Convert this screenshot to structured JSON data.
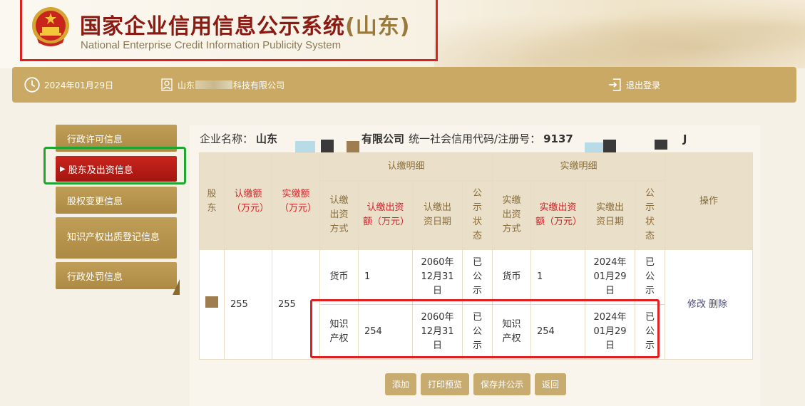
{
  "header": {
    "title_main": "国家企业信用信息公示系统",
    "title_province": "(山东)",
    "subtitle": "National Enterprise Credit Information Publicity System"
  },
  "topbar": {
    "date": "2024年01月29日",
    "company_prefix": "山东",
    "company_suffix": "科技有限公司",
    "logout": "退出登录"
  },
  "leftnav": {
    "items": [
      {
        "label": "行政许可信息",
        "active": false
      },
      {
        "label": "股东及出资信息",
        "active": true
      },
      {
        "label": "股权变更信息",
        "active": false
      },
      {
        "label": "知识产权出质登记信息",
        "active": false
      },
      {
        "label": "行政处罚信息",
        "active": false
      }
    ]
  },
  "company": {
    "name_label": "企业名称：",
    "name_prefix": "山东",
    "name_suffix": "有限公司",
    "code_label": "统一社会信用代码/注册号：",
    "code_prefix": "9137",
    "code_suffix": "J"
  },
  "table": {
    "group_subscribed": "认缴明细",
    "group_paid": "实缴明细",
    "headers": {
      "shareholder": "股东",
      "subscribed_amount": "认缴额（万元）",
      "paid_amount": "实缴额（万元）",
      "sub_method": "认缴出资方式",
      "sub_amount": "认缴出资额（万元）",
      "sub_date": "认缴出资日期",
      "sub_status": "公示状态",
      "paid_method": "实缴出资方式",
      "paid_amount2": "实缴出资额（万元）",
      "paid_date": "实缴出资日期",
      "paid_status": "公示状态",
      "ops": "操作"
    },
    "row": {
      "subscribed_total": "255",
      "paid_total": "255",
      "edit": "修改",
      "delete": "删除",
      "details": [
        {
          "sub_method": "货币",
          "sub_amount": "1",
          "sub_date": "2060年12月31日",
          "sub_status": "已公示",
          "paid_method": "货币",
          "paid_amount": "1",
          "paid_date": "2024年01月29日",
          "paid_status": "已公示"
        },
        {
          "sub_method": "知识产权",
          "sub_amount": "254",
          "sub_date": "2060年12月31日",
          "sub_status": "已公示",
          "paid_method": "知识产权",
          "paid_amount": "254",
          "paid_date": "2024年01月29日",
          "paid_status": "已公示"
        }
      ]
    }
  },
  "buttons": {
    "add": "添加",
    "print": "打印预览",
    "save_publish": "保存并公示",
    "back": "返回"
  },
  "colors": {
    "gold": "#c9a964",
    "nav_active": "#c8251d",
    "annotation_red": "#e02020",
    "annotation_green": "#1fa531"
  }
}
